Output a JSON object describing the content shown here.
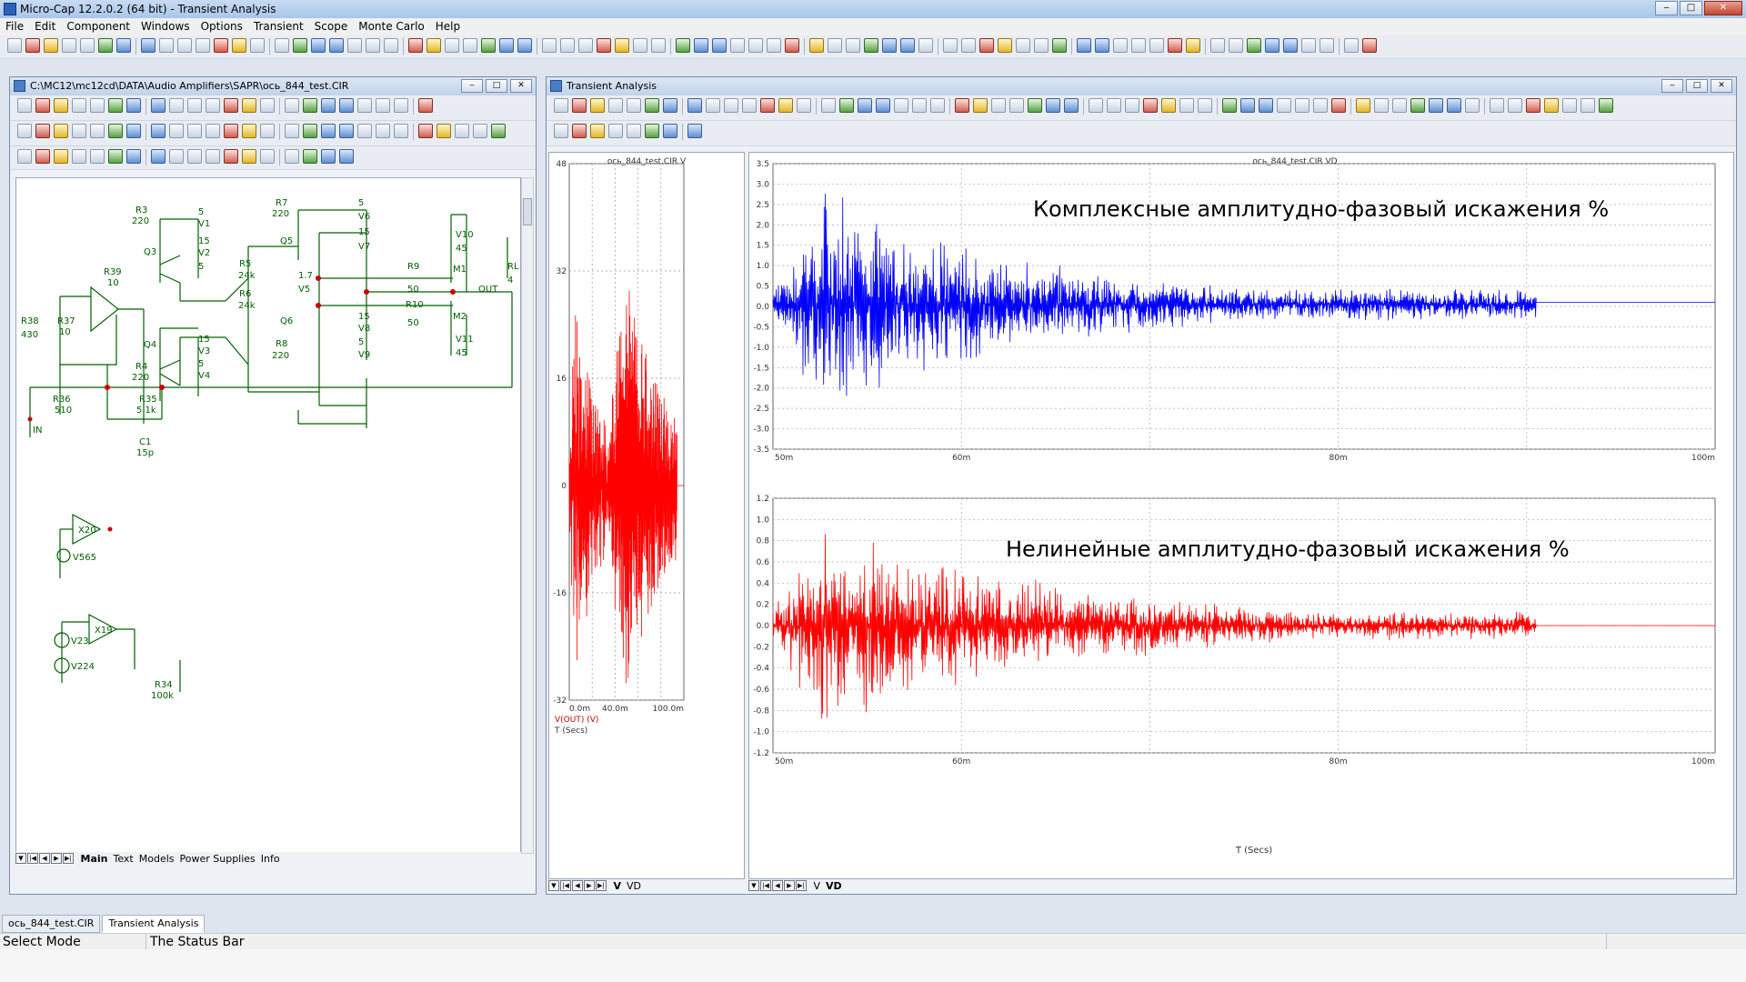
{
  "app": {
    "title": "Micro-Cap 12.2.0.2 (64 bit) - Transient Analysis",
    "menu": [
      "File",
      "Edit",
      "Component",
      "Windows",
      "Options",
      "Transient",
      "Scope",
      "Monte Carlo",
      "Help"
    ]
  },
  "schematic": {
    "path": "C:\\MC12\\mc12cd\\DATA\\Audio Amplifiers\\SAPR\\ось_844_test.CIR",
    "tabs": [
      "Main",
      "Text",
      "Models",
      "Power Supplies",
      "Info"
    ],
    "active_tab": "Main",
    "labels": {
      "r3": "R3",
      "r3v": "220",
      "v1": "V1",
      "v1v": "5",
      "v2": "V2",
      "v2a": "15",
      "v2b": "5",
      "q3": "Q3",
      "r39": "R39",
      "r39v": "10",
      "r38": "R38",
      "r38v": "430",
      "r37": "R37",
      "r37v": "10",
      "q4": "Q4",
      "r4": "R4",
      "r4v": "220",
      "v3": "V3",
      "v3a": "15",
      "v3b": "5",
      "v4": "V4",
      "r7": "R7",
      "r7v": "220",
      "v6": "V6",
      "v6a": "5",
      "v6b": "15",
      "v7": "V7",
      "q5": "Q5",
      "r5": "R5",
      "r5v": "24k",
      "r6": "R6",
      "r6v": "24k",
      "n17": "1.7",
      "v5": "V5",
      "q6": "Q6",
      "r8": "R8",
      "r8v": "220",
      "v8": "V8",
      "v8a": "15",
      "v8b": "5",
      "v9": "V9",
      "r9": "R9",
      "r9v": "50",
      "r10": "R10",
      "r10v": "50",
      "m1": "M1",
      "m2": "M2",
      "v10": "V10",
      "v10v": "45",
      "v11": "V11",
      "v11v": "45",
      "out": "OUT",
      "rl": "RL",
      "rlv": "4",
      "r36": "R36",
      "r36v": "510",
      "r35": "R35",
      "r35v": "5.1k",
      "c1": "C1",
      "c1v": "15p",
      "in": "IN",
      "x20": "X20",
      "v565": "V565",
      "x19": "X19",
      "v23": "V23",
      "v224": "V224",
      "r34": "R34",
      "r34v": "100k"
    }
  },
  "analysis": {
    "title": "Transient Analysis",
    "tabs": [
      "V",
      "VD"
    ],
    "active_tab": "VD"
  },
  "plot_v": {
    "header": "ось_844_test.CIR V",
    "ylabel": "V(OUT) (V)",
    "xlabel": "T (Secs)"
  },
  "plot_vd": {
    "header": "ось_844_test.CIR VD",
    "xlabel": "T (Secs)",
    "annotation_top": "Комплексные амплитудно-фазовый искажения %",
    "annotation_bottom": "Нелинейные амплитудно-фазовый искажения %"
  },
  "chart_data": [
    {
      "type": "line",
      "x_ticks": [
        "0.0m",
        "40.0m",
        "100.0m"
      ],
      "y_ticks": [
        "48",
        "32",
        "16",
        "0",
        "-16",
        "-32"
      ],
      "xlim": [
        0,
        0.1
      ],
      "ylim": [
        -32,
        48
      ],
      "series": [
        {
          "name": "V(OUT) (V)",
          "color": "#ff0000",
          "envelope": "two bursts, peak approx -30..+28 V, ends at t=0.1 s"
        }
      ]
    },
    {
      "type": "line",
      "x_ticks": [
        "50m",
        "60m",
        "80m",
        "100m"
      ],
      "y_ticks": [
        "3.5",
        "3.0",
        "2.5",
        "2.0",
        "1.5",
        "1.0",
        "0.5",
        "0.0",
        "-0.5",
        "-1.0",
        "-1.5",
        "-2.0",
        "-2.5",
        "-3.0",
        "-3.5"
      ],
      "xlim": [
        0.05,
        0.1
      ],
      "ylim": [
        -3.5,
        3.5
      ],
      "series": [
        {
          "color": "#0000ff",
          "envelope": "noise burst, peak approx +2.5/-2.3 at 55m, decaying to ±0.4 by 90m, flat 0.1 after 90m"
        }
      ]
    },
    {
      "type": "line",
      "x_ticks": [
        "50m",
        "60m",
        "80m",
        "100m"
      ],
      "y_ticks": [
        "1.2",
        "1.0",
        "0.8",
        "0.6",
        "0.4",
        "0.2",
        "0.0",
        "-0.2",
        "-0.4",
        "-0.6",
        "-0.8",
        "-1.0",
        "-1.2"
      ],
      "xlim": [
        0.05,
        0.1
      ],
      "ylim": [
        -1.2,
        1.2
      ],
      "series": [
        {
          "color": "#ff0000",
          "envelope": "noise burst, peak approx +0.8/-1.0 at 54m, decaying to ±0.15 by 90m, flat 0.0 after 90m"
        }
      ]
    }
  ],
  "bottom_tabs": [
    "ось_844_test.CIR",
    "Transient Analysis"
  ],
  "status": {
    "mode": "Select Mode",
    "text": "The Status Bar"
  }
}
